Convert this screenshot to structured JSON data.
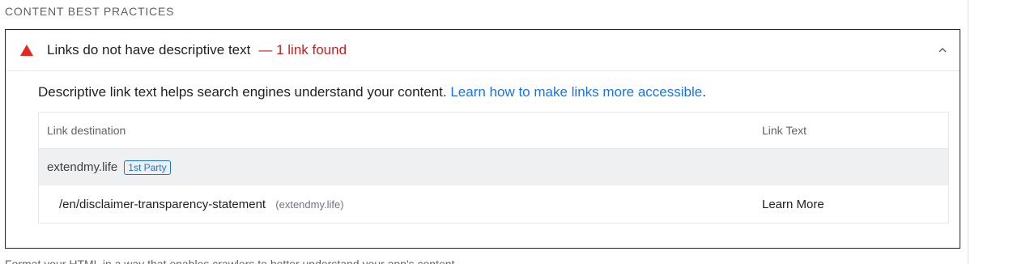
{
  "section": {
    "title": "CONTENT BEST PRACTICES"
  },
  "audit": {
    "title": "Links do not have descriptive text",
    "display_value": "— 1 link found",
    "description_text": "Descriptive link text helps search engines understand your content. ",
    "learn_more_link": "Learn how to make links more accessible",
    "description_end": ".",
    "status_color": "#e8281f"
  },
  "table": {
    "headers": [
      "Link destination",
      "Link Text"
    ],
    "entity": {
      "name": "extendmy.life",
      "badge": "1st Party"
    },
    "rows": [
      {
        "url": "/en/disclaimer-transparency-statement",
        "host": "(extendmy.life)",
        "text": "Learn More"
      }
    ]
  },
  "footer": {
    "partial_text": "Format your HTML in a way that enables crawlers to better understand your app's content."
  }
}
